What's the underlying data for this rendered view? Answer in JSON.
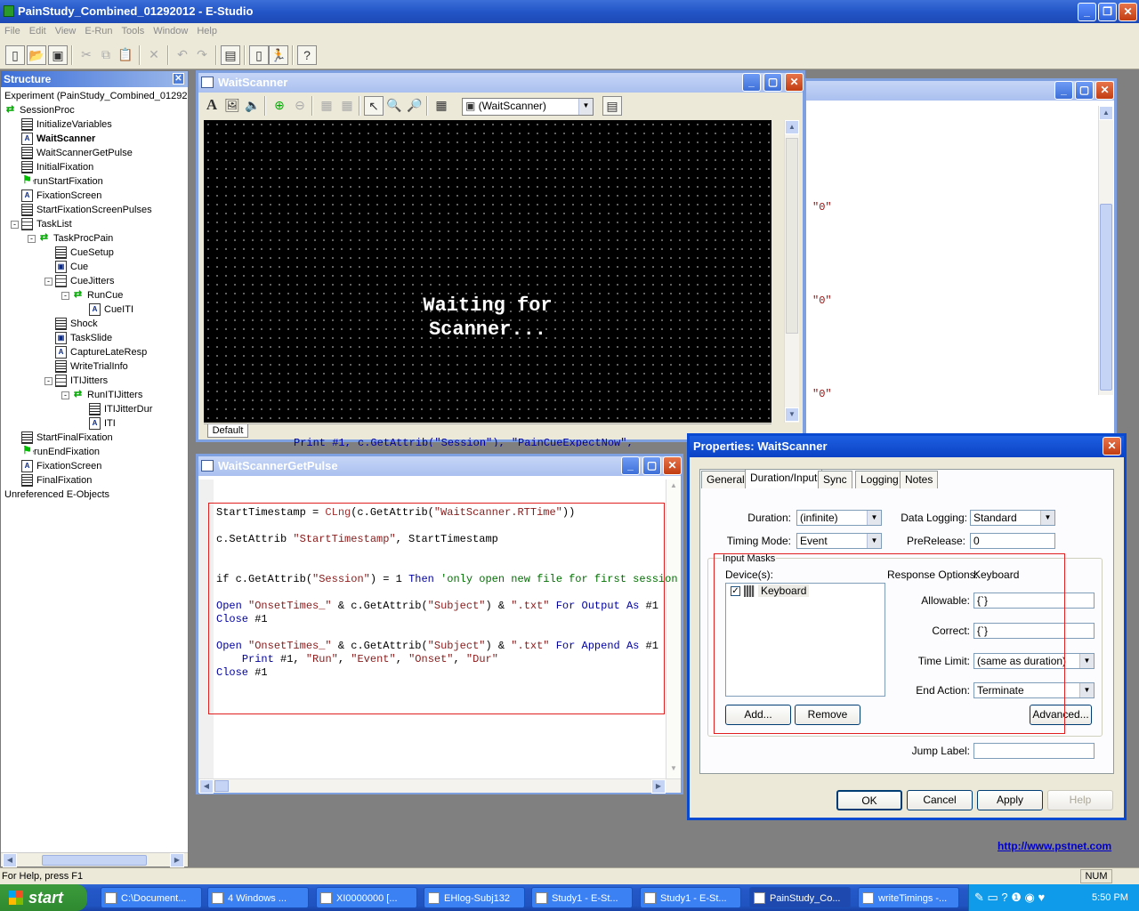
{
  "app": {
    "title": "PainStudy_Combined_01292012 - E-Studio",
    "menus": [
      "File",
      "Edit",
      "View",
      "E-Run",
      "Tools",
      "Window",
      "Help"
    ]
  },
  "structure": {
    "title": "Structure",
    "items": [
      {
        "label": "Experiment (PainStudy_Combined_01292",
        "depth": 0,
        "icon": "experiment"
      },
      {
        "label": "SessionProc",
        "depth": 0,
        "icon": "procedure"
      },
      {
        "label": "InitializeVariables",
        "depth": 1,
        "icon": "inline"
      },
      {
        "label": "WaitScanner",
        "depth": 1,
        "icon": "textdisplay",
        "bold": true
      },
      {
        "label": "WaitScannerGetPulse",
        "depth": 1,
        "icon": "inline"
      },
      {
        "label": "InitialFixation",
        "depth": 1,
        "icon": "inline"
      },
      {
        "label": "RerunStartFixation",
        "depth": 1,
        "icon": "label"
      },
      {
        "label": "FixationScreen",
        "depth": 1,
        "icon": "textdisplay"
      },
      {
        "label": "StartFixationScreenPulses",
        "depth": 1,
        "icon": "inline"
      },
      {
        "label": "TaskList",
        "depth": 1,
        "icon": "list",
        "exp": "-"
      },
      {
        "label": "TaskProcPain",
        "depth": 2,
        "icon": "procedure",
        "exp": "-"
      },
      {
        "label": "CueSetup",
        "depth": 3,
        "icon": "inline"
      },
      {
        "label": "Cue",
        "depth": 3,
        "icon": "slide"
      },
      {
        "label": "CueJitters",
        "depth": 3,
        "icon": "list",
        "exp": "-"
      },
      {
        "label": "RunCue",
        "depth": 4,
        "icon": "procedure",
        "exp": "-"
      },
      {
        "label": "CueITI",
        "depth": 5,
        "icon": "textdisplay"
      },
      {
        "label": "Shock",
        "depth": 3,
        "icon": "inline"
      },
      {
        "label": "TaskSlide",
        "depth": 3,
        "icon": "slide"
      },
      {
        "label": "CaptureLateResp",
        "depth": 3,
        "icon": "textdisplay"
      },
      {
        "label": "WriteTrialInfo",
        "depth": 3,
        "icon": "inline"
      },
      {
        "label": "ITIJitters",
        "depth": 3,
        "icon": "list",
        "exp": "-"
      },
      {
        "label": "RunITIJitters",
        "depth": 4,
        "icon": "procedure",
        "exp": "-"
      },
      {
        "label": "ITIJitterDur",
        "depth": 5,
        "icon": "inline"
      },
      {
        "label": "ITI",
        "depth": 5,
        "icon": "textdisplay"
      },
      {
        "label": "StartFinalFixation",
        "depth": 1,
        "icon": "inline"
      },
      {
        "label": "RerunEndFixation",
        "depth": 1,
        "icon": "label"
      },
      {
        "label": "FixationScreen",
        "depth": 1,
        "icon": "textdisplay"
      },
      {
        "label": "FinalFixation",
        "depth": 1,
        "icon": "inline"
      },
      {
        "label": "Unreferenced E-Objects",
        "depth": 0,
        "icon": "none"
      }
    ]
  },
  "waitscanner": {
    "title": "WaitScanner",
    "object_select": "(WaitScanner)",
    "display_text": "Waiting for\nScanner...",
    "tab": "Default",
    "behind_text": "Print #1, c.GetAttrib(\"Session\"), \"PainCueExpectNow\","
  },
  "background_window": {
    "values": [
      "\"0\"",
      "\"0\"",
      "\"0\""
    ]
  },
  "getpulse": {
    "title": "WaitScannerGetPulse",
    "lines": [
      [
        [
          "StartTimestamp = ",
          ""
        ],
        [
          "CLng",
          "fn"
        ],
        [
          "(c.GetAttrib(",
          ""
        ],
        [
          "\"WaitScanner.RTTime\"",
          "str"
        ],
        [
          "))",
          ""
        ]
      ],
      [],
      [
        [
          "c.SetAttrib ",
          ""
        ],
        [
          "\"StartTimestamp\"",
          "str"
        ],
        [
          ", StartTimestamp",
          ""
        ]
      ],
      [],
      [],
      [
        [
          "if",
          ""
        ],
        [
          " c.GetAttrib(",
          ""
        ],
        [
          "\"Session\"",
          "str"
        ],
        [
          ") = 1 ",
          ""
        ],
        [
          "Then",
          "kw"
        ],
        [
          " 'only open new file for first session",
          "cm"
        ]
      ],
      [],
      [
        [
          "Open",
          "kw"
        ],
        [
          " ",
          ""
        ],
        [
          "\"OnsetTimes_\"",
          "str"
        ],
        [
          " & c.GetAttrib(",
          ""
        ],
        [
          "\"Subject\"",
          "str"
        ],
        [
          ") & ",
          ""
        ],
        [
          "\".txt\"",
          "str"
        ],
        [
          " ",
          ""
        ],
        [
          "For",
          "kw"
        ],
        [
          " ",
          ""
        ],
        [
          "Output",
          "kw"
        ],
        [
          " ",
          ""
        ],
        [
          "As",
          "kw"
        ],
        [
          " #1",
          ""
        ]
      ],
      [
        [
          "Close",
          "kw"
        ],
        [
          " #1",
          ""
        ]
      ],
      [],
      [
        [
          "Open",
          "kw"
        ],
        [
          " ",
          ""
        ],
        [
          "\"OnsetTimes_\"",
          "str"
        ],
        [
          " & c.GetAttrib(",
          ""
        ],
        [
          "\"Subject\"",
          "str"
        ],
        [
          ") & ",
          ""
        ],
        [
          "\".txt\"",
          "str"
        ],
        [
          " ",
          ""
        ],
        [
          "For",
          "kw"
        ],
        [
          " ",
          ""
        ],
        [
          "Append",
          "kw"
        ],
        [
          " ",
          ""
        ],
        [
          "As",
          "kw"
        ],
        [
          " #1",
          ""
        ]
      ],
      [
        [
          "    ",
          ""
        ],
        [
          "Print",
          "kw"
        ],
        [
          " #1, ",
          ""
        ],
        [
          "\"Run\"",
          "str"
        ],
        [
          ", ",
          ""
        ],
        [
          "\"Event\"",
          "str"
        ],
        [
          ", ",
          ""
        ],
        [
          "\"Onset\"",
          "str"
        ],
        [
          ", ",
          ""
        ],
        [
          "\"Dur\"",
          "str"
        ]
      ],
      [
        [
          "Close",
          "kw"
        ],
        [
          " #1",
          ""
        ]
      ]
    ]
  },
  "properties": {
    "title": "Properties: WaitScanner",
    "tabs": [
      "General",
      "Duration/Input",
      "Sync",
      "Logging",
      "Notes"
    ],
    "duration_label": "Duration:",
    "duration": "(infinite)",
    "timing_mode_label": "Timing Mode:",
    "timing_mode": "Event",
    "data_logging_label": "Data Logging:",
    "data_logging": "Standard",
    "prerelease_label": "PreRelease:",
    "prerelease": "0",
    "input_masks": "Input Masks",
    "devices_label": "Device(s):",
    "device": "Keyboard",
    "response_options_label": "Response Options:",
    "response_options": "Keyboard",
    "allowable_label": "Allowable:",
    "allowable": "{`}",
    "correct_label": "Correct:",
    "correct": "{`}",
    "time_limit_label": "Time Limit:",
    "time_limit": "(same as duration)",
    "end_action_label": "End Action:",
    "end_action": "Terminate",
    "jump_label_label": "Jump Label:",
    "jump_label": "",
    "add": "Add...",
    "remove": "Remove",
    "advanced": "Advanced...",
    "ok": "OK",
    "cancel": "Cancel",
    "apply": "Apply",
    "help": "Help"
  },
  "link": "http://www.pstnet.com",
  "status": {
    "text": "For Help, press F1",
    "num": "NUM"
  },
  "taskbar": {
    "start": "start",
    "tasks": [
      "C:\\Document...",
      "4 Windows ...",
      "XI0000000 [...",
      "EHlog-Subj132",
      "Study1 - E-St...",
      "Study1 - E-St...",
      "PainStudy_Co...",
      "writeTimings -..."
    ],
    "clock": "5:50 PM"
  }
}
